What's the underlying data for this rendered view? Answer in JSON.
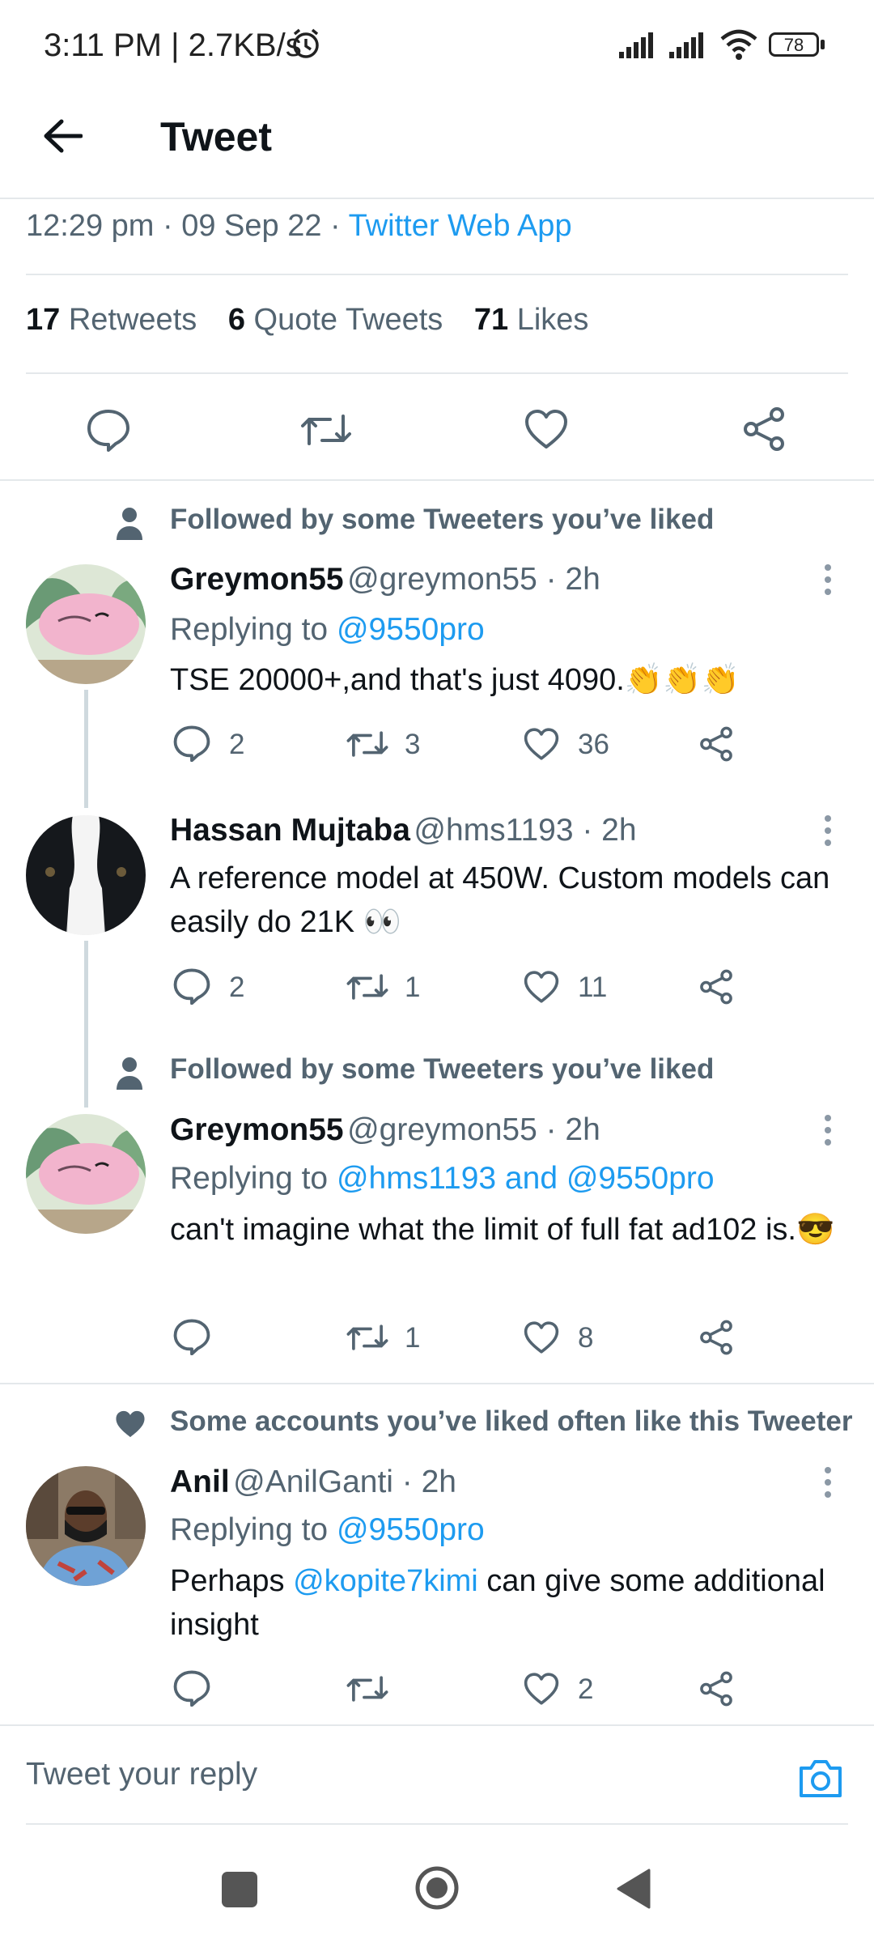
{
  "status_bar": {
    "time_speed": "3:11 PM | 2.7KB/s",
    "battery": "78"
  },
  "header": {
    "title": "Tweet"
  },
  "tweet_meta": {
    "time": "12:29 pm",
    "date": "09 Sep 22",
    "source": "Twitter Web App"
  },
  "stats": {
    "retweets_count": "17",
    "retweets_label": "Retweets",
    "quotes_count": "6",
    "quotes_label": "Quote Tweets",
    "likes_count": "71",
    "likes_label": "Likes"
  },
  "replies": [
    {
      "context": "Followed by some Tweeters you’ve liked",
      "name": "Greymon55",
      "handle": "@greymon55 · 2h",
      "replying_label": "Replying to",
      "replying_to": "@9550pro",
      "text": "TSE 20000+,and that's just 4090.👏👏👏",
      "replies": "2",
      "retweets": "3",
      "likes": "36"
    },
    {
      "context": "",
      "name": "Hassan Mujtaba",
      "handle": "@hms1193 · 2h",
      "text": "A reference model at 450W. Custom models can easily do 21K 👀",
      "replies": "2",
      "retweets": "1",
      "likes": "11"
    },
    {
      "context": "Followed by some Tweeters you’ve liked",
      "name": "Greymon55",
      "handle": "@greymon55 · 2h",
      "replying_label": "Replying to",
      "replying_to": "@hms1193 and @9550pro",
      "text": "can't imagine what the limit of full fat ad102 is.😎",
      "replies": "",
      "retweets": "1",
      "likes": "8"
    },
    {
      "context": "Some accounts you’ve liked often like this Tweeter",
      "name": "Anil",
      "handle": "@AnilGanti · 2h",
      "replying_label": "Replying to",
      "replying_to": "@9550pro",
      "text_before": "Perhaps ",
      "text_mention": "@kopite7kimi",
      "text_after": " can give some additional insight",
      "replies": "",
      "retweets": "",
      "likes": "2"
    }
  ],
  "composer": {
    "placeholder": "Tweet your reply"
  },
  "icons": {
    "back": "back-arrow-icon",
    "reply": "reply-icon",
    "retweet": "retweet-icon",
    "like": "heart-icon",
    "share": "share-icon",
    "camera": "camera-icon",
    "person": "person-icon",
    "more": "more-vertical-icon"
  },
  "colors": {
    "accent": "#1d9bf0",
    "muted": "#536471",
    "text": "#0f1419"
  }
}
